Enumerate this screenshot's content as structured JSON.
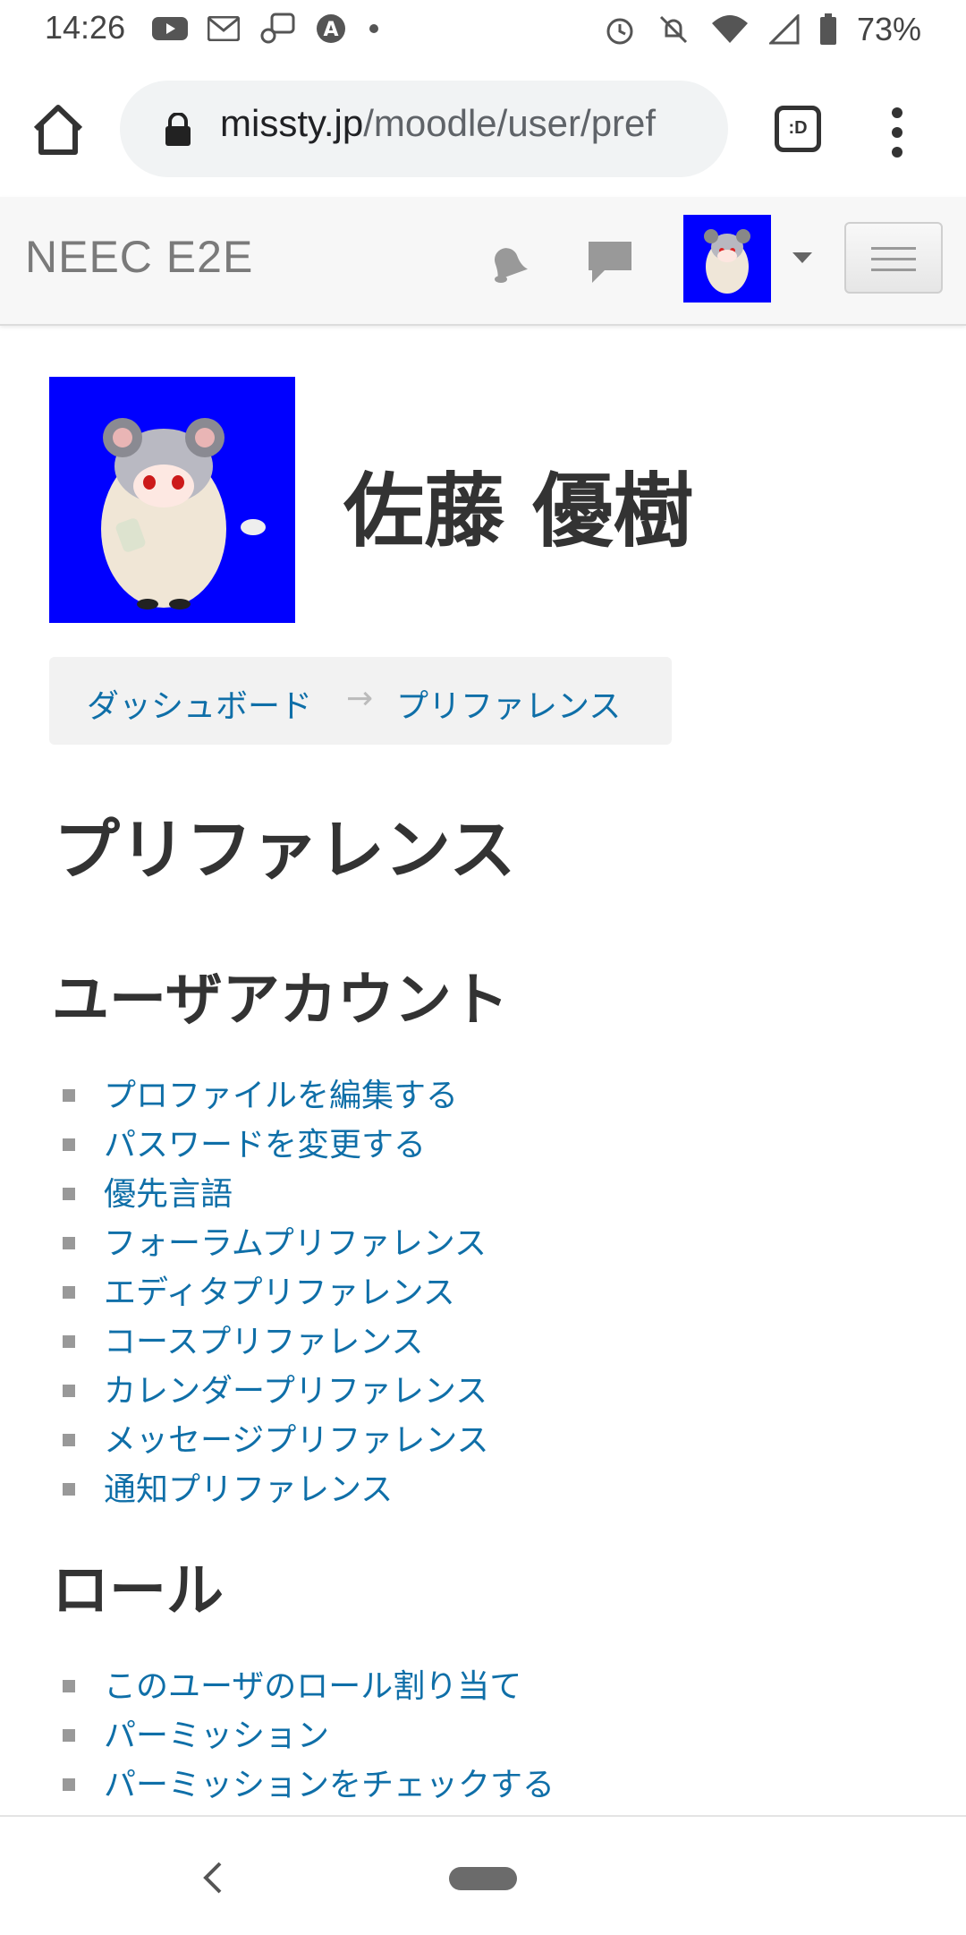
{
  "status_bar": {
    "time": "14:26",
    "battery": "73%",
    "icons": [
      "youtube-icon",
      "gmail-icon",
      "podcast-icon",
      "accessibility-icon",
      "dot-icon",
      "alarm-icon",
      "mute-icon",
      "wifi-icon",
      "signal-icon",
      "battery-icon"
    ]
  },
  "browser": {
    "url_host": "missty.jp",
    "url_path": "/moodle/user/pref",
    "tabs_label": ":D"
  },
  "navbar": {
    "brand": "NEEC E2E"
  },
  "profile": {
    "fullname": "佐藤 優樹"
  },
  "breadcrumb": {
    "items": [
      "ダッシュボード",
      "プリファレンス"
    ],
    "separator": "→"
  },
  "page": {
    "title": "プリファレンス",
    "sections": [
      {
        "title": "ユーザアカウント",
        "links": [
          "プロファイルを編集する",
          "パスワードを変更する",
          "優先言語",
          "フォーラムプリファレンス",
          "エディタプリファレンス",
          "コースプリファレンス",
          "カレンダープリファレンス",
          "メッセージプリファレンス",
          "通知プリファレンス"
        ]
      },
      {
        "title": "ロール",
        "links": [
          "このユーザのロール割り当て",
          "パーミッション",
          "パーミッションをチェックする"
        ]
      }
    ]
  },
  "colors": {
    "link": "#0f6fa8",
    "avatar_bg": "#0000ff",
    "heading": "#333333"
  }
}
